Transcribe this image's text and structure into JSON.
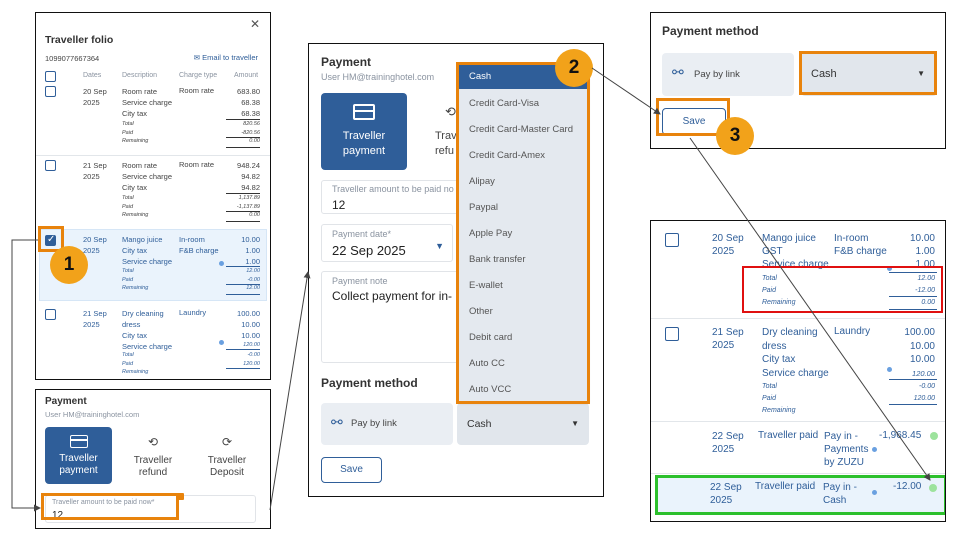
{
  "folio": {
    "title": "Traveller folio",
    "id": "1099077667364",
    "email_label": "Email to traveller",
    "headers": {
      "dates": "Dates",
      "description": "Description",
      "charge_type": "Charge type",
      "amount": "Amount"
    },
    "rows": [
      {
        "date": "20 Sep",
        "year": "2025",
        "lines": [
          "Room rate",
          "Service charge",
          "City tax"
        ],
        "charge_type": "Room rate",
        "amounts": [
          "683.80",
          "68.38",
          "68.38"
        ],
        "sub_labels": [
          "Total",
          "Paid",
          "Remaining"
        ],
        "sub_values": [
          "820.56",
          "-820.56",
          "0.00"
        ]
      },
      {
        "date": "21 Sep",
        "year": "2025",
        "lines": [
          "Room rate",
          "Service charge",
          "City tax"
        ],
        "charge_type": "Room rate",
        "amounts": [
          "948.24",
          "94.82",
          "94.82"
        ],
        "sub_labels": [
          "Total",
          "Paid",
          "Remaining"
        ],
        "sub_values": [
          "1,137.89",
          "-1,137.89",
          "0.00"
        ]
      },
      {
        "date": "20 Sep",
        "year": "2025",
        "lines": [
          "Mango juice",
          "City tax",
          "Service charge"
        ],
        "charge_types": [
          "In-room",
          "F&B charge"
        ],
        "amounts": [
          "10.00",
          "1.00",
          "1.00"
        ],
        "sub_labels": [
          "Total",
          "Paid",
          "Remaining"
        ],
        "sub_values": [
          "12.00",
          "-0.00",
          "12.00"
        ]
      },
      {
        "date": "21 Sep",
        "year": "2025",
        "lines": [
          "Dry cleaning",
          "dress",
          "City tax",
          "Service charge"
        ],
        "charge_type": "Laundry",
        "amounts": [
          "100.00",
          "10.00",
          "10.00",
          "120.00"
        ],
        "sub_labels": [
          "Total",
          "Paid",
          "Remaining"
        ],
        "sub_values": [
          "-0.00",
          "120.00"
        ]
      }
    ]
  },
  "payment_small": {
    "title": "Payment",
    "user": "User HM@traininghotel.com",
    "tabs": [
      "Traveller payment",
      "Traveller refund",
      "Traveller Deposit"
    ],
    "amount_label": "Traveller amount to be paid now*",
    "amount_value": "12"
  },
  "payment_main": {
    "title": "Payment",
    "user": "User HM@traininghotel.com",
    "tab_active": "Traveller payment",
    "tab_partial": "Trav refu",
    "amount_label": "Traveller amount to be paid no",
    "amount_value": "12",
    "date_label": "Payment date*",
    "date_value": "22 Sep 2025",
    "note_label": "Payment note",
    "note_value": "Collect payment for in-",
    "method_title": "Payment method",
    "pay_by_link": "Pay by link",
    "method_value": "Cash",
    "save": "Save"
  },
  "dropdown": {
    "options": [
      "Cash",
      "Credit Card-Visa",
      "Credit Card-Master Card",
      "Credit Card-Amex",
      "Alipay",
      "Paypal",
      "Apple Pay",
      "Bank transfer",
      "E-wallet",
      "Other",
      "Debit card",
      "Auto CC",
      "Auto VCC"
    ]
  },
  "method_panel": {
    "title": "Payment method",
    "pay_by_link": "Pay by link",
    "value": "Cash",
    "save": "Save"
  },
  "result": {
    "row1": {
      "date": "20 Sep",
      "year": "2025",
      "lines": [
        "Mango juice",
        "GST",
        "Service charge"
      ],
      "types": [
        "In-room",
        "F&B charge"
      ],
      "amounts": [
        "10.00",
        "1.00",
        "1.00"
      ],
      "sub_labels": [
        "Total",
        "Paid",
        "Remaining"
      ],
      "sub_values": [
        "12.00",
        "-12.00",
        "0.00"
      ]
    },
    "row2": {
      "date": "21 Sep",
      "year": "2025",
      "lines": [
        "Dry cleaning",
        "dress",
        "City tax",
        "Service charge"
      ],
      "type": "Laundry",
      "amounts": [
        "100.00",
        "10.00",
        "10.00",
        "120.00"
      ],
      "sub_labels": [
        "Total",
        "Paid",
        "Remaining"
      ],
      "sub_values": [
        "-0.00",
        "120.00"
      ]
    },
    "row3": {
      "date": "22 Sep",
      "year": "2025",
      "desc": "Traveller paid",
      "method_lines": [
        "Pay in -",
        "Payments",
        "by ZUZU"
      ],
      "amount": "-1,968.45"
    },
    "row4": {
      "date": "22 Sep",
      "year": "2025",
      "desc": "Traveller paid",
      "method_lines": [
        "Pay in -",
        "Cash"
      ],
      "amount": "-12.00"
    }
  },
  "steps": [
    "1",
    "2",
    "3"
  ],
  "colors": {
    "accent": "#2f5e99",
    "highlight": "#e8830c",
    "badge": "#f2a21a",
    "red": "#e01010",
    "green": "#2cc02c"
  }
}
